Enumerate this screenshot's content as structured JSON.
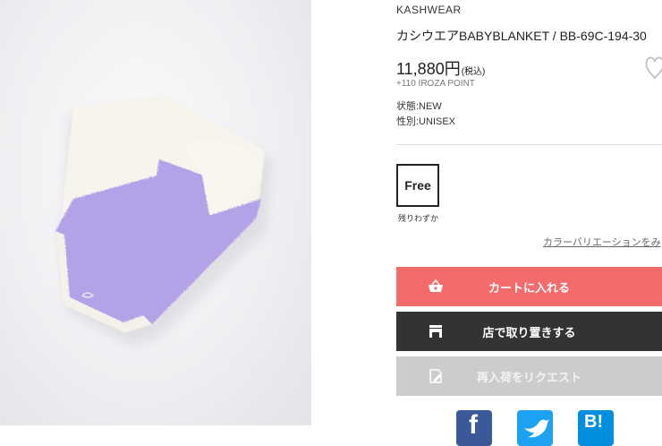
{
  "product": {
    "brand": "KASHWEAR",
    "title": "カシウエアBABYBLANKET / BB-69C-194-30",
    "price": "11,880円",
    "tax_note": "(税込)",
    "points": "+110 IROZA POINT",
    "condition": "状態:NEW",
    "gender": "性別:UNISEX"
  },
  "size": {
    "label": "Free",
    "stock_note": "残りわずか"
  },
  "variation_link": "カラーバリエーションをみ",
  "buttons": {
    "cart": "カートに入れる",
    "store": "店で取り置きする",
    "restock": "再入荷をリクエスト"
  },
  "share": {
    "facebook_glyph": "f",
    "twitter_icon": "bird-icon",
    "hatena_glyph": "B!"
  },
  "colors": {
    "cart": "#f46b6b",
    "store": "#333333",
    "restock": "#cccccc",
    "facebook": "#3b5998",
    "twitter": "#1da1f2",
    "hatena": "#008fde"
  }
}
